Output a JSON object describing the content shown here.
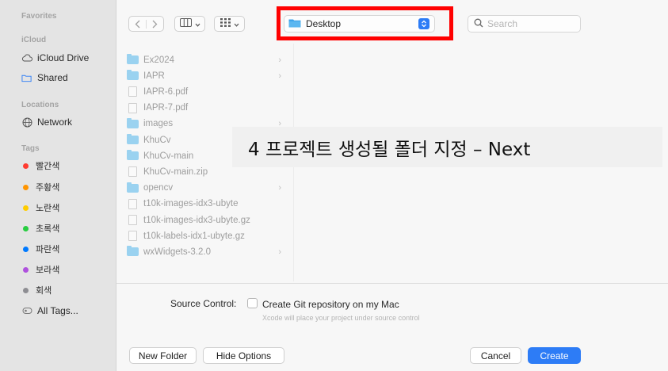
{
  "sidebar": {
    "favorites_header": "Favorites",
    "icloud_header": "iCloud",
    "icloud_items": [
      {
        "label": "iCloud Drive",
        "icon": "cloud-icon"
      },
      {
        "label": "Shared",
        "icon": "shared-folder-icon"
      }
    ],
    "locations_header": "Locations",
    "location_items": [
      {
        "label": "Network",
        "icon": "globe-icon"
      }
    ],
    "tags_header": "Tags",
    "tags": [
      {
        "label": "빨간색",
        "color": "#ff3b30"
      },
      {
        "label": "주황색",
        "color": "#ff9500"
      },
      {
        "label": "노란색",
        "color": "#ffcc00"
      },
      {
        "label": "초록색",
        "color": "#28cd41"
      },
      {
        "label": "파란색",
        "color": "#007aff"
      },
      {
        "label": "보라색",
        "color": "#af52de"
      },
      {
        "label": "회색",
        "color": "#8e8e93"
      }
    ],
    "all_tags": "All Tags..."
  },
  "toolbar": {
    "location": "Desktop",
    "search_placeholder": "Search"
  },
  "files": [
    {
      "name": "Ex2024",
      "type": "folder",
      "has_children": true
    },
    {
      "name": "IAPR",
      "type": "folder",
      "has_children": true
    },
    {
      "name": "IAPR-6.pdf",
      "type": "file",
      "has_children": false
    },
    {
      "name": "IAPR-7.pdf",
      "type": "file",
      "has_children": false
    },
    {
      "name": "images",
      "type": "folder",
      "has_children": true
    },
    {
      "name": "KhuCv",
      "type": "folder",
      "has_children": false
    },
    {
      "name": "KhuCv-main",
      "type": "folder",
      "has_children": false
    },
    {
      "name": "KhuCv-main.zip",
      "type": "file",
      "has_children": false
    },
    {
      "name": "opencv",
      "type": "folder",
      "has_children": true
    },
    {
      "name": "t10k-images-idx3-ubyte",
      "type": "file",
      "has_children": false
    },
    {
      "name": "t10k-images-idx3-ubyte.gz",
      "type": "file",
      "has_children": false
    },
    {
      "name": "t10k-labels-idx1-ubyte.gz",
      "type": "file",
      "has_children": false
    },
    {
      "name": "wxWidgets-3.2.0",
      "type": "folder",
      "has_children": true
    }
  ],
  "source_control": {
    "label": "Source Control:",
    "checkbox_label": "Create Git repository on my Mac",
    "checked": false,
    "subtext": "Xcode will place your project under source control"
  },
  "buttons": {
    "new_folder": "New Folder",
    "hide_options": "Hide Options",
    "cancel": "Cancel",
    "create": "Create"
  },
  "overlay_caption": "4 프로젝트 생성될 폴더 지정 – Next",
  "colors": {
    "accent": "#2d7cf6",
    "highlight": "#ff0000",
    "folder": "#7cc6ee"
  }
}
